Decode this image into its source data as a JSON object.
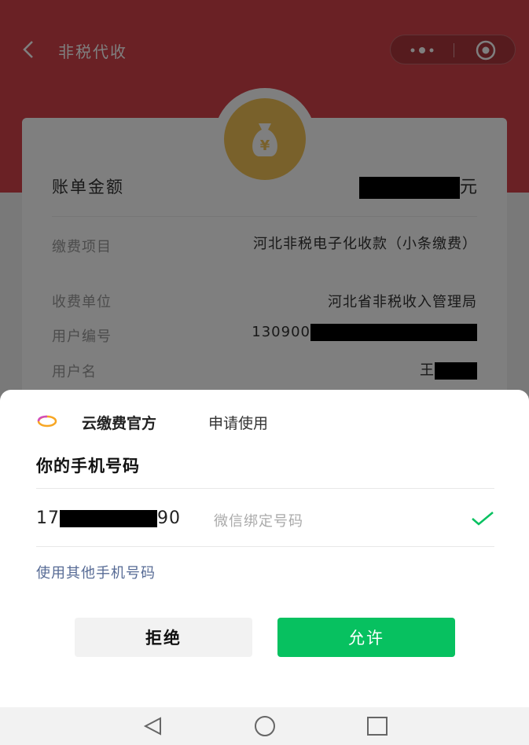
{
  "header": {
    "back_icon": "chevron-left-icon",
    "title": "非税代收",
    "capsule": {
      "more_icon": "more-dots-icon",
      "close_icon": "target-circle-icon"
    },
    "color": "#d4434b"
  },
  "bill": {
    "badge_icon": "money-bag-yen-icon",
    "badge_glyph": "¥",
    "amount_label": "账单金额",
    "amount_unit": "元",
    "rows": [
      {
        "label": "缴费项目",
        "value": "河北非税电子化收款（小条缴费）"
      },
      {
        "label": "收费单位",
        "value": "河北省非税收入管理局"
      },
      {
        "label": "用户编号",
        "value": "130900"
      },
      {
        "label": "用户名",
        "value": "王"
      }
    ]
  },
  "auth": {
    "app_name": "云缴费官方",
    "request_text": "申请使用",
    "title": "你的手机号码",
    "phone_prefix": "17",
    "phone_suffix": "90",
    "phone_tag": "微信绑定号码",
    "other_phone": "使用其他手机号码",
    "deny_label": "拒绝",
    "allow_label": "允许",
    "allow_color": "#07c160",
    "link_color": "#576b95"
  },
  "navbar": {
    "back_icon": "triangle-back-icon",
    "home_icon": "circle-home-icon",
    "recent_icon": "square-recent-icon"
  }
}
